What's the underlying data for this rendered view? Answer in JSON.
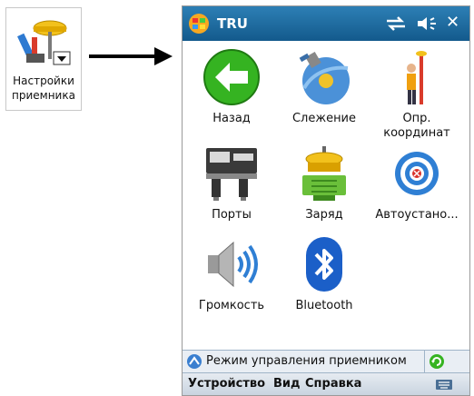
{
  "launcher": {
    "label_line1": "Настройки",
    "label_line2": "приемника"
  },
  "device": {
    "title": "TRU",
    "items": [
      {
        "label": "Назад",
        "icon": "back-arrow-icon"
      },
      {
        "label": "Слежение",
        "icon": "satellite-dish-icon"
      },
      {
        "label_line1": "Опр.",
        "label_line2": "координат",
        "icon": "surveyor-pole-icon"
      },
      {
        "label": "Порты",
        "icon": "ports-icon"
      },
      {
        "label": "Заряд",
        "icon": "charge-icon"
      },
      {
        "label": "Автоустано...",
        "icon": "target-icon"
      },
      {
        "label": "Громкость",
        "icon": "speaker-icon"
      },
      {
        "label": "Bluetooth",
        "icon": "bluetooth-icon"
      }
    ],
    "status_text": "Режим управления приемником",
    "menu": {
      "device": "Устройство",
      "view": "Вид",
      "help": "Справка"
    }
  },
  "colors": {
    "titlebar": "#1b6aa0",
    "back_green": "#33b31f",
    "bluetooth": "#1b5fc8"
  }
}
